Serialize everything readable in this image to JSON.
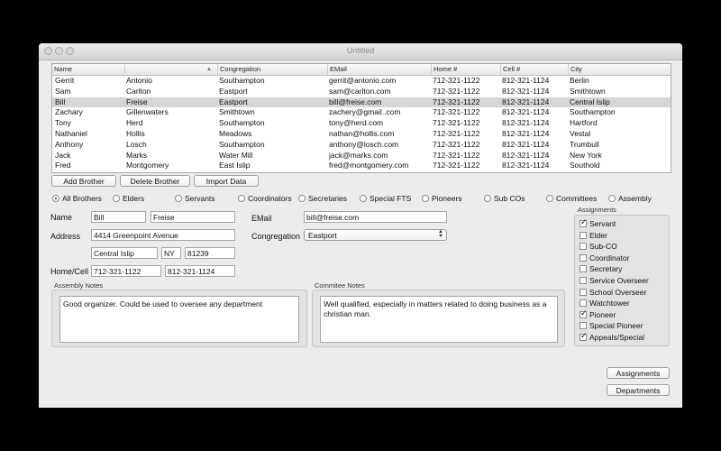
{
  "window": {
    "title": "Untitled"
  },
  "table": {
    "columns": [
      "Name",
      "",
      "Congregation",
      "EMail",
      "Home #",
      "Cell #",
      "City"
    ],
    "rows": [
      [
        "Gerrit",
        "Antonio",
        "Southampton",
        "gerrit@antonio.com",
        "712-321-1122",
        "812-321-1124",
        "Berlin"
      ],
      [
        "Sam",
        "Carlton",
        "Eastport",
        "sam@carlton.com",
        "712-321-1122",
        "812-321-1124",
        "Smithtown"
      ],
      [
        "Bill",
        "Freise",
        "Eastport",
        "bill@freise.com",
        "712-321-1122",
        "812-321-1124",
        "Central Islip"
      ],
      [
        "Zachary",
        "Gillenwaters",
        "Smithtown",
        "zachery@gmail..com",
        "712-321-1122",
        "812-321-1124",
        "Southampton"
      ],
      [
        "Tony",
        "Herd",
        "Southampton",
        "tony@herd.com",
        "712-321-1122",
        "812-321-1124",
        "Hartford"
      ],
      [
        "Nathaniel",
        "Hollis",
        "Meadows",
        "nathan@hollis.com",
        "712-321-1122",
        "812-321-1124",
        "Vestal"
      ],
      [
        "Anthony",
        "Losch",
        "Southampton",
        "anthony@losch.com",
        "712-321-1122",
        "812-321-1124",
        "Trumbull"
      ],
      [
        "Jack",
        "Marks",
        "Water Mill",
        "jack@marks.com",
        "712-321-1122",
        "812-321-1124",
        "New York"
      ],
      [
        "Fred",
        "Montgomery",
        "East Islip",
        "fred@montgomery.com",
        "712-321-1122",
        "812-321-1124",
        "Southold"
      ]
    ],
    "selected_index": 2
  },
  "buttons": {
    "add": "Add Brother",
    "delete": "Delete Brother",
    "import": "Import Data",
    "assignments": "Assignments",
    "departments": "Departments"
  },
  "filters": {
    "selected": "All Brothers",
    "options": [
      "All Brothers",
      "Elders",
      "Servants",
      "Coordinators",
      "Secretaries",
      "Special FTS",
      "Pioneers",
      "Sub COs",
      "Committees",
      "Assembly"
    ]
  },
  "form": {
    "name_label": "Name",
    "first_name": "Bill",
    "last_name": "Freise",
    "address_label": "Address",
    "street": "4414 Greenpoint Avenue",
    "city": "Central Islip",
    "state": "NY",
    "zip": "81239",
    "phone_label": "Home/Cell",
    "home_phone": "712-321-1122",
    "cell_phone": "812-321-1124",
    "email_label": "EMail",
    "email": "bill@freise.com",
    "congregation_label": "Congregation",
    "congregation": "Eastport"
  },
  "notes": {
    "assembly_title": "Assembly Notes",
    "assembly_text": "Good organizer.  Could be used to oversee any department",
    "committee_title": "Commitee Notes",
    "committee_text": "Well qualified, especially in matters related to doing business as a christian man."
  },
  "assignments": {
    "title": "Assignments",
    "items": [
      {
        "label": "Servant",
        "checked": true
      },
      {
        "label": "Elder",
        "checked": false
      },
      {
        "label": "Sub-CO",
        "checked": false
      },
      {
        "label": "Coordinator",
        "checked": false
      },
      {
        "label": "Secretary",
        "checked": false
      },
      {
        "label": "Service Overseer",
        "checked": false
      },
      {
        "label": "School Overseer",
        "checked": false
      },
      {
        "label": "Watchtower",
        "checked": false
      },
      {
        "label": "Pioneer",
        "checked": true
      },
      {
        "label": "Special Pioneer",
        "checked": false
      },
      {
        "label": "Appeals/Special",
        "checked": true
      }
    ]
  }
}
